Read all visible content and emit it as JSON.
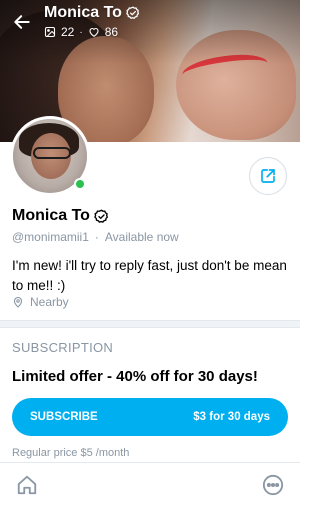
{
  "header": {
    "name": "Monica To",
    "media_count": "22",
    "likes_count": "86",
    "stats_separator": "·"
  },
  "profile": {
    "name": "Monica To",
    "handle": "@monimamii1",
    "handle_separator": "·",
    "status": "Available now",
    "bio": "I'm new! i'll try to reply fast, just don't be mean to me!! :)",
    "location": "Nearby",
    "online": true
  },
  "subscription": {
    "heading": "SUBSCRIPTION",
    "offer": "Limited offer - 40% off for 30 days!",
    "button_label": "SUBSCRIBE",
    "button_price": "$3 for 30 days",
    "regular_price": "Regular price $5 /month"
  },
  "icons": {
    "back": "arrow-left-icon",
    "verified": "verified-badge-icon",
    "media": "image-icon",
    "likes": "heart-icon",
    "share": "share-icon",
    "location": "location-pin-icon",
    "home": "home-icon",
    "more": "more-dots-icon"
  },
  "colors": {
    "accent": "#00aff0",
    "online": "#2bc04f",
    "muted_text": "#8a96a3"
  }
}
